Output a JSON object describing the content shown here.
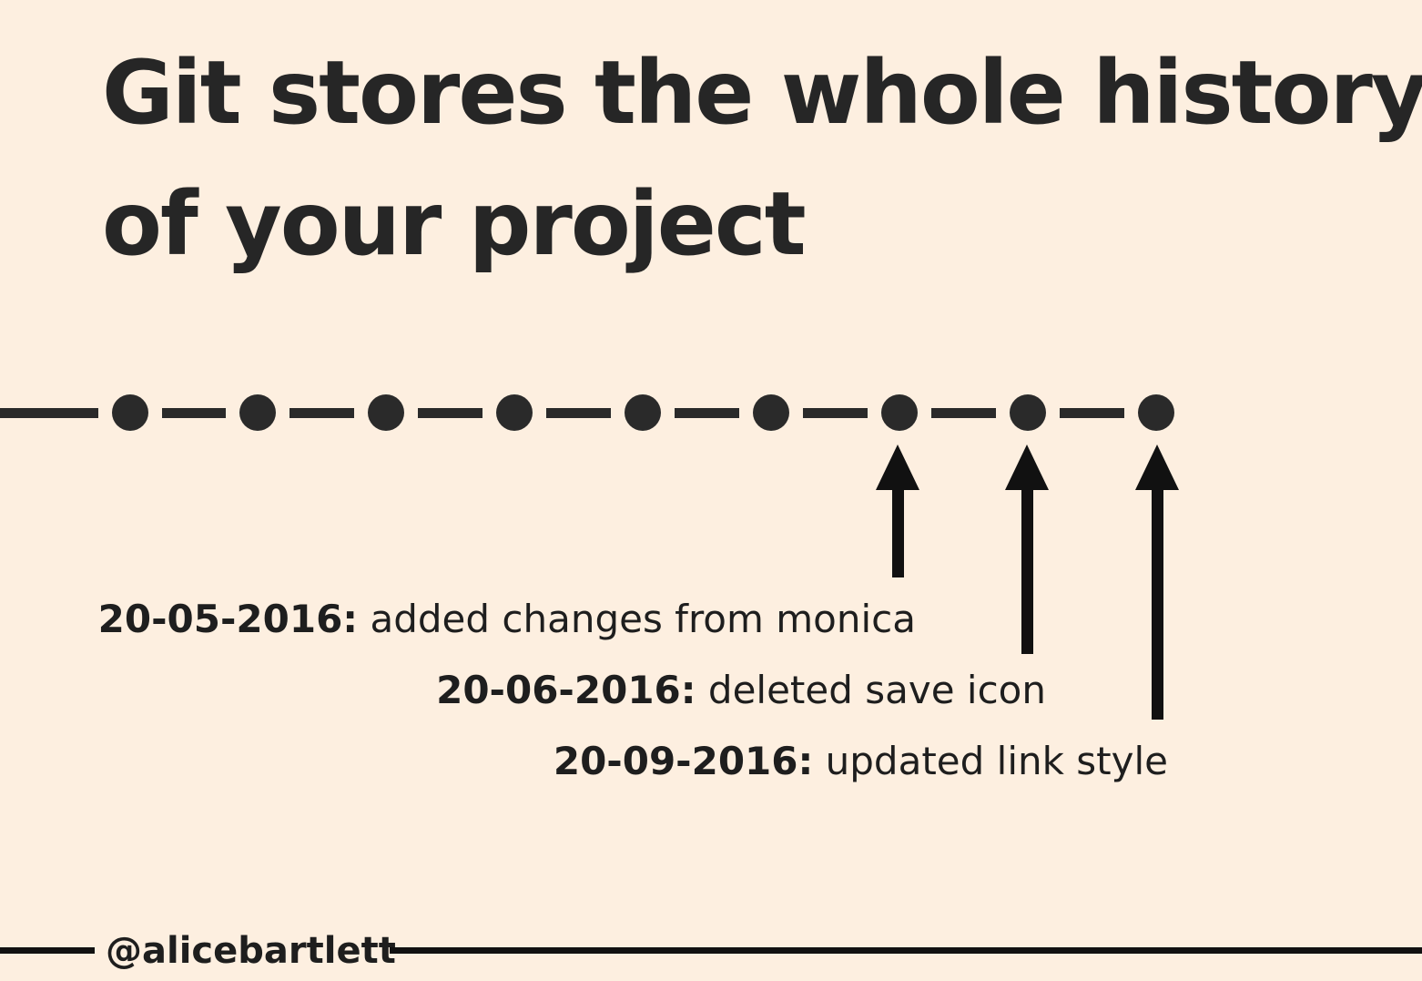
{
  "title_lines": [
    "Git stores the whole history",
    "of your project"
  ],
  "commits": [
    {
      "date": "20-05-2016:",
      "message": "added changes from monica"
    },
    {
      "date": "20-06-2016:",
      "message": "deleted save icon"
    },
    {
      "date": "20-09-2016:",
      "message": "updated link style"
    }
  ],
  "footer": {
    "handle": "@alicebartlett"
  },
  "colors": {
    "background": "#fdefe0",
    "ink": "#262626",
    "arrow": "#111111"
  }
}
